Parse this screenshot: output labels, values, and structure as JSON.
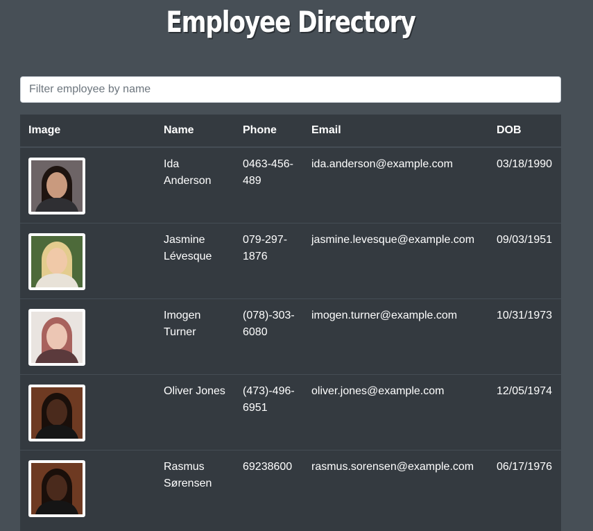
{
  "header": {
    "title": "Employee Directory"
  },
  "search": {
    "placeholder": "Filter employee by name",
    "value": ""
  },
  "table": {
    "columns": [
      "Image",
      "Name",
      "Phone",
      "Email",
      "DOB"
    ],
    "rows": [
      {
        "image": "portrait-photo",
        "name": "Ida Anderson",
        "phone": "0463-456-489",
        "email": "ida.anderson@example.com",
        "dob": "03/18/1990",
        "photo_colors": {
          "bg": "#6d6466",
          "hair": "#1e1410",
          "skin": "#c99a7e",
          "shirt": "#2f2f33"
        }
      },
      {
        "image": "portrait-photo",
        "name": "Jasmine Lévesque",
        "phone": "079-297-1876",
        "email": "jasmine.levesque@example.com",
        "dob": "09/03/1951",
        "photo_colors": {
          "bg": "#4d6a3a",
          "hair": "#e3cc8e",
          "skin": "#f0c9a8",
          "shirt": "#e8e2d8"
        }
      },
      {
        "image": "portrait-photo",
        "name": "Imogen Turner",
        "phone": "(078)-303-6080",
        "email": "imogen.turner@example.com",
        "dob": "10/31/1973",
        "photo_colors": {
          "bg": "#e9e4e0",
          "hair": "#a8625d",
          "skin": "#ecc6b4",
          "shirt": "#5b3a3c"
        }
      },
      {
        "image": "portrait-photo",
        "name": "Oliver Jones",
        "phone": "(473)-496-6951",
        "email": "oliver.jones@example.com",
        "dob": "12/05/1974",
        "photo_colors": {
          "bg": "#6e3a22",
          "hair": "#1a0f0a",
          "skin": "#4a2a1c",
          "shirt": "#151515"
        }
      },
      {
        "image": "portrait-photo",
        "name": "Rasmus Sørensen",
        "phone": "69238600",
        "email": "rasmus.sorensen@example.com",
        "dob": "06/17/1976",
        "photo_colors": {
          "bg": "#6e3a22",
          "hair": "#1a0f0a",
          "skin": "#4a2a1c",
          "shirt": "#151515"
        }
      }
    ]
  },
  "colors": {
    "page_bg": "#474f56",
    "table_bg": "#343a40",
    "row_border": "#454d55",
    "text": "#ffffff"
  }
}
